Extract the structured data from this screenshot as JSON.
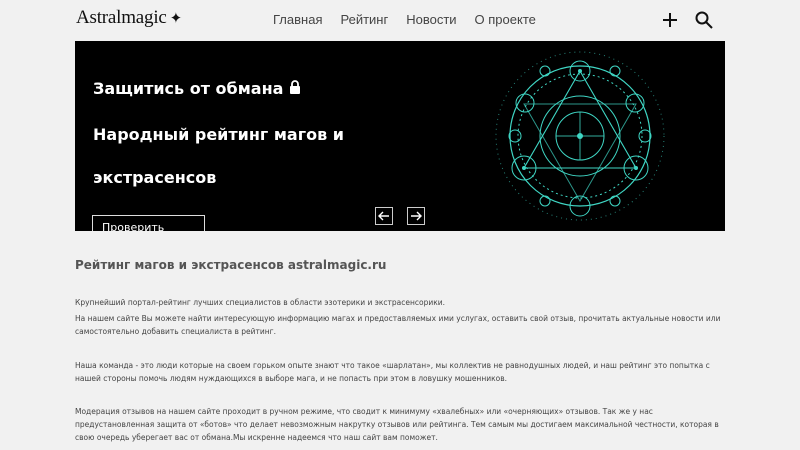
{
  "header": {
    "logo": "Astralmagic",
    "nav": [
      "Главная",
      "Рейтинг",
      "Новости",
      "О проекте"
    ],
    "icons": [
      "plus-icon",
      "search-icon"
    ]
  },
  "hero": {
    "line1": "Защитись от обмана",
    "line2": "Народный рейтинг магов и",
    "line3": "экстрасенсов",
    "button": "Проверить мага",
    "icons": [
      "lock-icon",
      "arrow-left-icon",
      "arrow-right-icon",
      "magic-circle-icon"
    ]
  },
  "content": {
    "title": "Рейтинг магов и экстрасенсов astralmagic.ru",
    "p1": "Крупнейший портал-рейтинг лучших специалистов в области эзотерики и экстрасенсорики.",
    "p2": "На нашем сайте Вы можете найти интересующую информацию магах и предоставляемых ими услугах, оставить свой отзыв, прочитать актуальные новости или самостоятельно добавить специалиста в рейтинг.",
    "p3": "Наша команда - это люди которые на своем горьком опыте знают что такое «шарлатан», мы коллектив не равнодушных людей, и наш рейтинг это попытка с нашей стороны помочь людям нуждающихся в выборе мага, и не попасть при этом в ловушку мошенников.",
    "p4": "Модерация отзывов на нашем сайте проходит в ручном режиме, что сводит к минимуму «хвалебных» или «очерняющих» отзывов. Так же у нас предустановленная защита от «ботов» что делает невозможным накрутку отзывов или рейтинга. Тем самым мы достигаем максимальной честности, которая в свою очередь уберегает вас от обмана.Мы искренне надеемся что наш сайт вам поможет."
  },
  "colors": {
    "accent": "#3fd6c4",
    "hero_bg": "#000000",
    "page_bg": "#f1f1f1"
  }
}
